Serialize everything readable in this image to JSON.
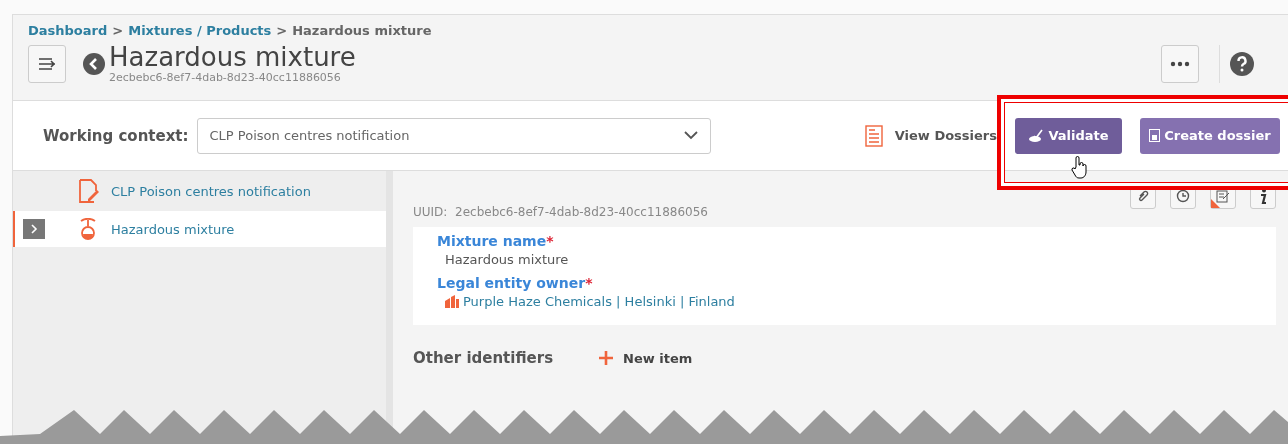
{
  "breadcrumb": [
    {
      "label": "Dashboard",
      "kind": "link"
    },
    {
      "label": "Mixtures / Products",
      "kind": "link"
    },
    {
      "label": "Hazardous mixture",
      "kind": "current"
    }
  ],
  "breadcrumb_separator": ">",
  "page": {
    "title": "Hazardous mixture",
    "subtitle": "2ecbebc6-8ef7-4dab-8d23-40cc11886056"
  },
  "working_context": {
    "label": "Working context:",
    "value": "CLP Poison centres notification"
  },
  "actions": [
    {
      "label": "View Dossiers",
      "kind": "link"
    },
    {
      "label": "Validate",
      "kind": "primary"
    },
    {
      "label": "Create dossier",
      "kind": "secondary"
    }
  ],
  "tree": [
    {
      "label": "CLP Poison centres notification",
      "kind": "notification",
      "selected": false,
      "expandable": false
    },
    {
      "label": "Hazardous mixture",
      "kind": "mixture",
      "selected": true,
      "expandable": true
    }
  ],
  "uuid": {
    "label": "UUID:",
    "value": "2ecbebc6-8ef7-4dab-8d23-40cc11886056"
  },
  "fields": [
    {
      "label": "Mixture name",
      "required_mark": "*",
      "value": "Hazardous mixture",
      "kind": "text"
    },
    {
      "label": "Legal entity owner",
      "required_mark": "*",
      "value": "Purple Haze Chemicals | Helsinki | Finland",
      "kind": "link"
    }
  ],
  "section": {
    "title": "Other identifiers",
    "add_label": "New item"
  }
}
